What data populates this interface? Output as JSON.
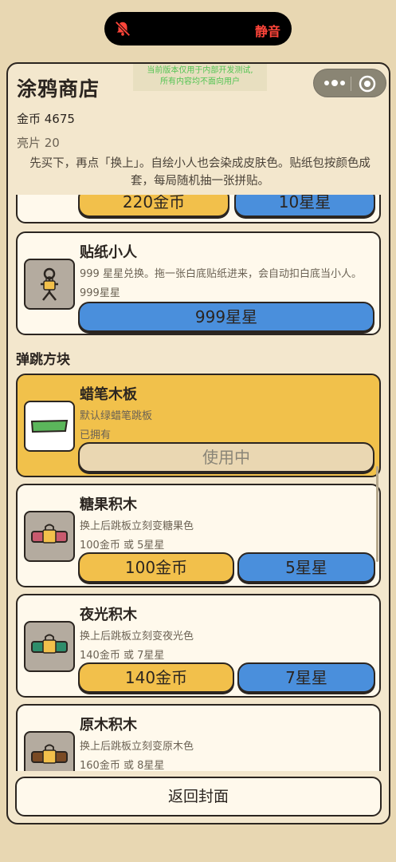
{
  "status_bar": {
    "mute_label": "静音"
  },
  "header": {
    "title": "涂鸦商店",
    "coins": "金币 4675",
    "shards": "亮片 20",
    "dev_notice_line1": "当前版本仅用于内部开发测试,",
    "dev_notice_line2": "所有内容均不面向用户",
    "hint": "先买下，再点「换上」。自绘小人也会染成皮肤色。贴纸包按颜色成套，每局随机抽一张拼贴。"
  },
  "partial_item": {
    "coin_label": "220金币",
    "star_label": "10星星"
  },
  "sticker_item": {
    "title": "贴纸小人",
    "desc": "999 星星兑换。拖一张白底贴纸进来，会自动扣白底当小人。",
    "price": "999星星",
    "star_label": "999星星"
  },
  "section": {
    "title": "弹跳方块"
  },
  "boards": [
    {
      "title": "蜡笔木板",
      "desc": "默认绿蜡笔跳板",
      "price": "已拥有",
      "action": "使用中",
      "color": "#5bb65b"
    },
    {
      "title": "糖果积木",
      "desc": "换上后跳板立刻变糖果色",
      "price": "100金币 或 5星星",
      "coin_label": "100金币",
      "star_label": "5星星",
      "color": "#c85a6e"
    },
    {
      "title": "夜光积木",
      "desc": "换上后跳板立刻变夜光色",
      "price": "140金币 或 7星星",
      "coin_label": "140金币",
      "star_label": "7星星",
      "color": "#2e8d6b"
    },
    {
      "title": "原木积木",
      "desc": "换上后跳板立刻变原木色",
      "price": "160金币 或 8星星",
      "color": "#7a4a24"
    }
  ],
  "footer": {
    "back_label": "返回封面"
  }
}
